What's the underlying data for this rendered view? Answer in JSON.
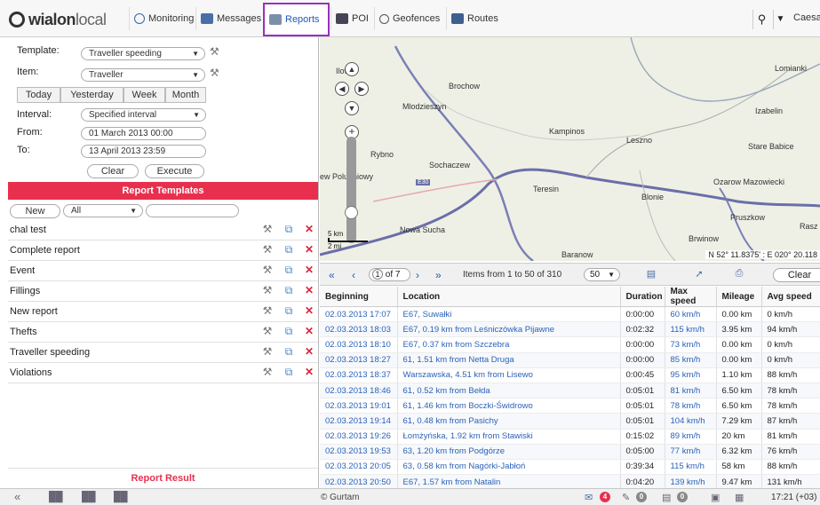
{
  "logo": {
    "part1": "wialon",
    "part2": "local"
  },
  "nav": [
    {
      "label": "Monitoring",
      "icon": "compass-icon"
    },
    {
      "label": "Messages",
      "icon": "messages-icon"
    },
    {
      "label": "Reports",
      "icon": "reports-icon"
    },
    {
      "label": "POI",
      "icon": "poi-icon"
    },
    {
      "label": "Geofences",
      "icon": "geofences-icon"
    },
    {
      "label": "Routes",
      "icon": "routes-icon"
    }
  ],
  "user": {
    "name": "Caesa"
  },
  "report_form": {
    "template_label": "Template:",
    "template_value": "Traveller speeding",
    "item_label": "Item:",
    "item_value": "Traveller",
    "quick_ranges": [
      "Today",
      "Yesterday",
      "Week",
      "Month"
    ],
    "interval_label": "Interval:",
    "interval_value": "Specified interval",
    "from_label": "From:",
    "from_value": "01 March 2013 00:00",
    "to_label": "To:",
    "to_value": "13 April 2013 23:59",
    "clear_label": "Clear",
    "execute_label": "Execute"
  },
  "templates": {
    "header": "Report Templates",
    "new_label": "New",
    "filter_value": "All",
    "search_value": "",
    "items": [
      "chal test",
      "Complete report",
      "Event",
      "Fillings",
      "New report",
      "Thefts",
      "Traveller speeding",
      "Violations"
    ]
  },
  "result": {
    "header": "Report Result"
  },
  "map": {
    "labels": [
      "Ilow",
      "Brochow",
      "Mlodzieszyn",
      "Kampinos",
      "Leszno",
      "Lomianki",
      "Izabelin",
      "Stare Babice",
      "Rybno",
      "Sochaczew",
      "ew Poludniowy",
      "Teresin",
      "Blonie",
      "Ozarow Mazowiecki",
      "Pruszkow",
      "Nowa Sucha",
      "Brwinow",
      "Baranow",
      "Rasz",
      "E30"
    ],
    "scale_km": "5 km",
    "scale_mi": "2 mi",
    "coords": "N 52° 11.8375' : E 020° 20.118"
  },
  "table": {
    "page_current": "1",
    "page_total": "of 7",
    "items_info": "Items from 1 to 50 of 310",
    "per_page": "50",
    "clear_label": "Clear",
    "columns": [
      "Beginning",
      "Location",
      "Duration",
      "Max speed",
      "Mileage",
      "Avg speed"
    ],
    "rows": [
      [
        "02.03.2013 17:07",
        "E67, Suwałki",
        "0:00:00",
        "60 km/h",
        "0.00 km",
        "0 km/h"
      ],
      [
        "02.03.2013 18:03",
        "E67, 0.19 km from Leśniczówka Pijawne",
        "0:02:32",
        "115 km/h",
        "3.95 km",
        "94 km/h"
      ],
      [
        "02.03.2013 18:10",
        "E67, 0.37 km from Szczebra",
        "0:00:00",
        "73 km/h",
        "0.00 km",
        "0 km/h"
      ],
      [
        "02.03.2013 18:27",
        "61, 1.51 km from Netta Druga",
        "0:00:00",
        "85 km/h",
        "0.00 km",
        "0 km/h"
      ],
      [
        "02.03.2013 18:37",
        "Warszawska, 4.51 km from Lisewo",
        "0:00:45",
        "95 km/h",
        "1.10 km",
        "88 km/h"
      ],
      [
        "02.03.2013 18:46",
        "61, 0.52 km from Bełda",
        "0:05:01",
        "81 km/h",
        "6.50 km",
        "78 km/h"
      ],
      [
        "02.03.2013 19:01",
        "61, 1.46 km from Boczki-Świdrowo",
        "0:05:01",
        "78 km/h",
        "6.50 km",
        "78 km/h"
      ],
      [
        "02.03.2013 19:14",
        "61, 0.48 km from Pasichy",
        "0:05:01",
        "104 km/h",
        "7.29 km",
        "87 km/h"
      ],
      [
        "02.03.2013 19:26",
        "Łomżyńska, 1.92 km from Stawiski",
        "0:15:02",
        "89 km/h",
        "20 km",
        "81 km/h"
      ],
      [
        "02.03.2013 19:53",
        "63, 1.20 km from Podgórze",
        "0:05:00",
        "77 km/h",
        "6.32 km",
        "76 km/h"
      ],
      [
        "02.03.2013 20:05",
        "63, 0.58 km from Nagórki-Jabłoń",
        "0:39:34",
        "115 km/h",
        "58 km",
        "88 km/h"
      ],
      [
        "02.03.2013 20:50",
        "E67, 1.57 km from Natalin",
        "0:04:20",
        "139 km/h",
        "9.47 km",
        "131 km/h"
      ]
    ]
  },
  "bottom": {
    "copyright": "© Gurtam",
    "badge1": "4",
    "badge2": "0",
    "badge3": "0",
    "clock": "17:21 (+03)"
  },
  "colors": {
    "accent": "#e8304e",
    "link": "#2b62b8",
    "active_nav_border": "#9b2fc0"
  }
}
